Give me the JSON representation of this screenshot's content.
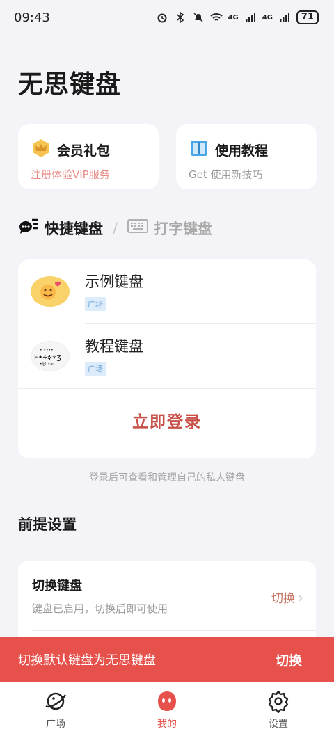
{
  "status_bar": {
    "time": "09:43",
    "network_1": "4G",
    "network_2": "4G",
    "battery": "71"
  },
  "app_title": "无思键盘",
  "promos": {
    "vip": {
      "title": "会员礼包",
      "subtitle": "注册体验VIP服务",
      "icon": "crown-icon"
    },
    "tutorial": {
      "title": "使用教程",
      "subtitle": "Get 使用新技巧",
      "icon": "book-icon"
    }
  },
  "tabs": {
    "active": "快捷键盘",
    "separator": "/",
    "inactive": "打字键盘"
  },
  "keyboards": [
    {
      "name": "示例键盘",
      "tag": "广场",
      "icon": "emoji-face-icon"
    },
    {
      "name": "教程键盘",
      "tag": "广场",
      "icon": "symbols-icon"
    }
  ],
  "login": {
    "button": "立即登录",
    "hint": "登录后可查看和管理自己的私人键盘"
  },
  "settings": {
    "section_title": "前提设置",
    "item": {
      "title": "切换键盘",
      "subtitle": "键盘已启用，切换后即可使用",
      "action": "切换"
    }
  },
  "banner": {
    "text": "切换默认键盘为无思键盘",
    "button": "切换"
  },
  "nav": [
    {
      "label": "广场",
      "icon": "planet-icon"
    },
    {
      "label": "我的",
      "icon": "profile-blob-icon"
    },
    {
      "label": "设置",
      "icon": "gear-icon"
    }
  ],
  "colors": {
    "accent": "#e7514b",
    "login_text": "#c85048",
    "tag_bg": "#dcecfb",
    "background": "#f3f3f8"
  }
}
